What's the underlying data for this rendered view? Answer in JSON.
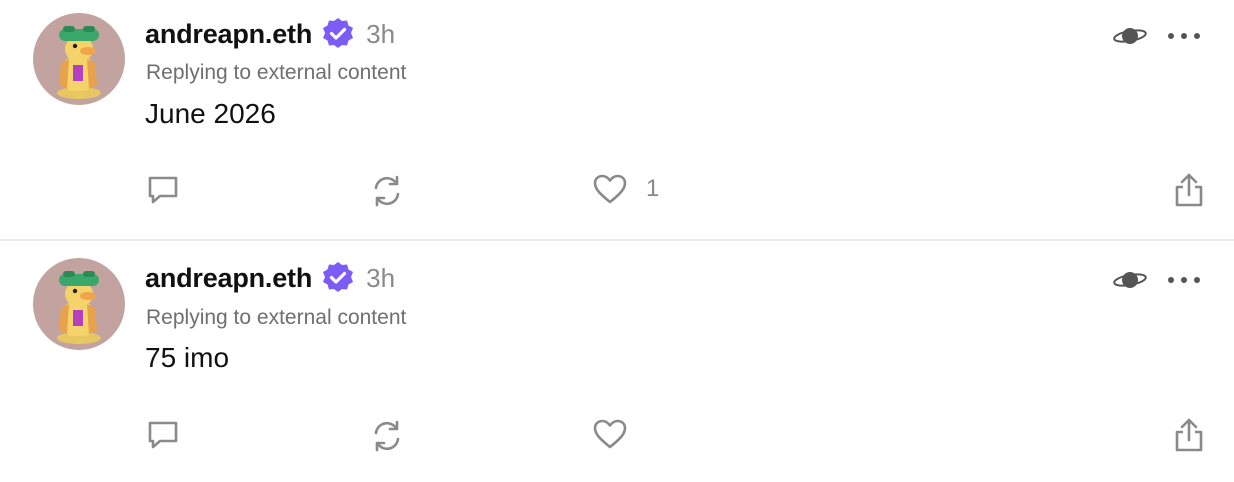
{
  "posts": [
    {
      "username": "andreapn.eth",
      "time": "3h",
      "reply_label": "Replying to external content",
      "text": "June 2026",
      "like_count": "1"
    },
    {
      "username": "andreapn.eth",
      "time": "3h",
      "reply_label": "Replying to external content",
      "text": "75 imo",
      "like_count": ""
    }
  ],
  "icons": {
    "verified": "verified-badge-icon",
    "planet": "planet-icon",
    "more": "more-horizontal-icon",
    "comment": "comment-icon",
    "repost": "repost-icon",
    "like": "heart-icon",
    "share": "share-icon"
  },
  "colors": {
    "verified": "#7c5cf5",
    "icon_gray": "#8a8a8a",
    "avatar_bg": "#c3a3a0",
    "divider": "#ececec"
  }
}
